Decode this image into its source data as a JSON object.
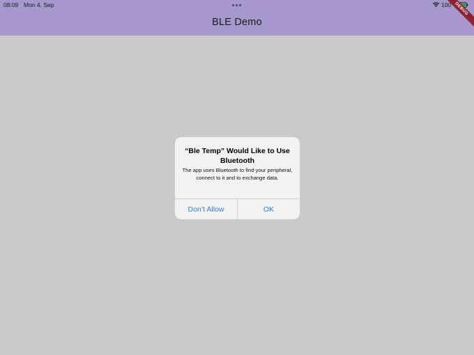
{
  "status_bar": {
    "time": "08:09",
    "date": "Mon 4. Sep",
    "battery_percent": "100",
    "icons": [
      "wifi-icon",
      "battery-icon",
      "multitask-dots-icon"
    ]
  },
  "debug_banner": "DEBUG",
  "app_bar": {
    "title": "BLE Demo",
    "color": "#a797cd"
  },
  "background_color": "#cbc9cc",
  "alert": {
    "title": "“Ble Temp” Would Like to Use Bluetooth",
    "message": "The app uses Bluetooth to find your peripheral, connect to it and to exchange data.",
    "buttons": [
      {
        "label": "Don’t Allow"
      },
      {
        "label": "OK"
      }
    ],
    "button_color": "#2f7fd6"
  }
}
